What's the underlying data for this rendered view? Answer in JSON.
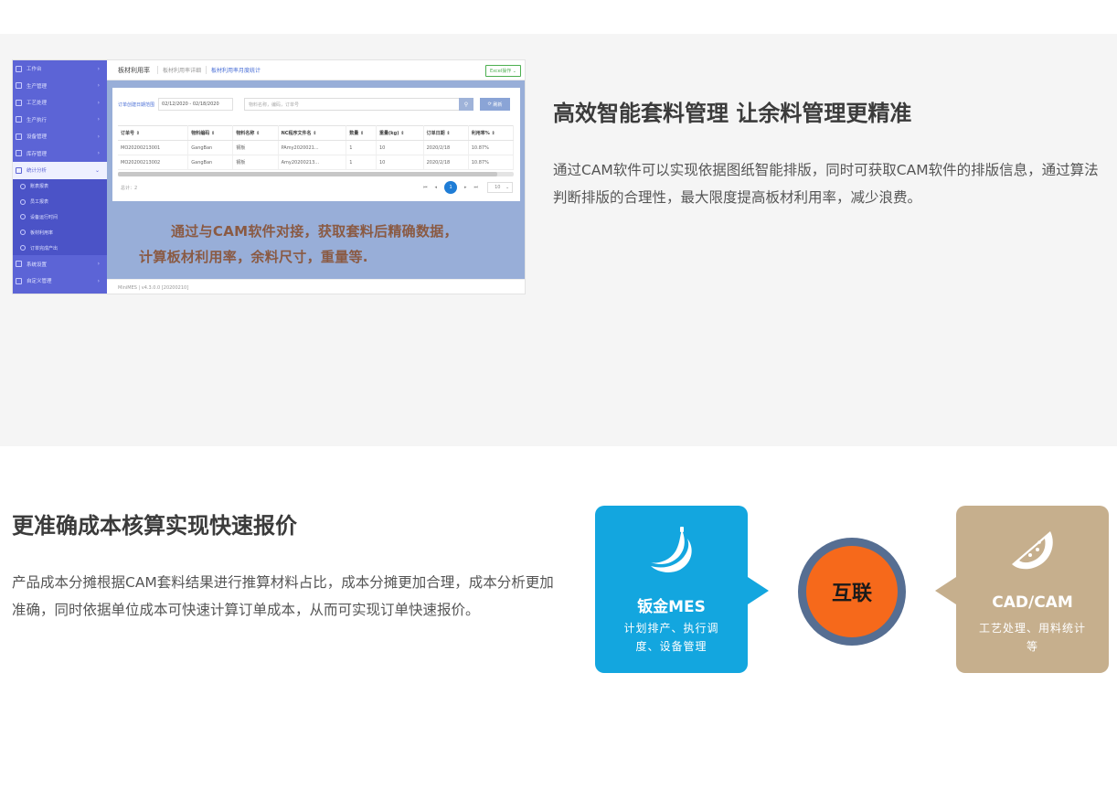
{
  "section1": {
    "title": "高效智能套料管理 让余料管理更精准",
    "paragraph": "通过CAM软件可以实现依据图纸智能排版，同时可获取CAM软件的排版信息，通过算法判断排版的合理性，最大限度提高板材利用率，减少浪费。",
    "screenshot": {
      "sidebar": [
        {
          "label": "工作台"
        },
        {
          "label": "生产管理"
        },
        {
          "label": "工艺处理"
        },
        {
          "label": "生产执行"
        },
        {
          "label": "设备管理"
        },
        {
          "label": "库存管理"
        },
        {
          "label": "统计分析",
          "active": true
        }
      ],
      "sidebar_sub": [
        {
          "label": "账表报表"
        },
        {
          "label": "员工报表"
        },
        {
          "label": "设备运行时间"
        },
        {
          "label": "板材利用率"
        },
        {
          "label": "订单完成产出"
        }
      ],
      "sidebar_after": [
        {
          "label": "系统设置"
        },
        {
          "label": "自定义管理"
        }
      ],
      "topbar": {
        "title": "板材利用率",
        "tab2": "板材利用率详细",
        "tab3": "板材利用率月度统计",
        "excel": "Excel操作"
      },
      "filter_label": "订单创建日期范围",
      "date_range": "02/12/2020 - 02/18/2020",
      "search_placeholder": "物料名称，编码，订单号",
      "search_icon": "search-icon",
      "refresh_label": "刷新",
      "columns": [
        "订单号",
        "物料编码",
        "物料名称",
        "NC程序文件名",
        "数量",
        "重量(kg)",
        "订单日期",
        "利用率%"
      ],
      "rows": [
        [
          "MO20200213001",
          "GangBan",
          "钢板",
          "PAmy2020021...",
          "1",
          "10",
          "2020/2/18",
          "10.87%"
        ],
        [
          "MO20200213002",
          "GangBan",
          "钢板",
          "Amy20200213...",
          "1",
          "10",
          "2020/2/18",
          "10.87%"
        ]
      ],
      "total": "总计：2",
      "page": "1",
      "page_size": "10",
      "overlay_line1": "通过与CAM软件对接，获取套料后精确数据，",
      "overlay_line2": "计算板材利用率，余料尺寸，重量等.",
      "version": "MiniMES | v4.3.0.0 [20200210]"
    }
  },
  "section2": {
    "title": "更准确成本核算实现快速报价",
    "paragraph": "产品成本分摊根据CAM套料结果进行推算材料占比，成本分摊更加合理，成本分析更加准确，同时依据单位成本可快速计算订单成本，从而可实现订单快速报价。",
    "left_box": {
      "title": "钣金MES",
      "desc": "计划排产、执行调度、设备管理",
      "icon": "banana-icon",
      "color": "#13a6df"
    },
    "hub": {
      "label": "互联",
      "color": "#f6691b",
      "ring": "#566e92"
    },
    "right_box": {
      "title": "CAD/CAM",
      "desc": "工艺处理、用料统计等",
      "icon": "watermelon-icon",
      "color": "#c6af8d"
    }
  }
}
